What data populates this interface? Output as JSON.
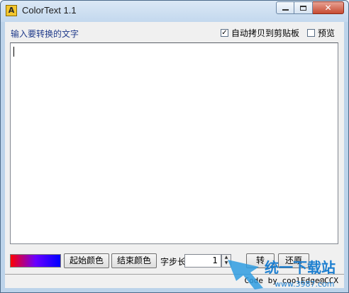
{
  "window": {
    "title": "ColorText 1.1",
    "icon": "app-a-icon",
    "controls": {
      "minimize": "minimize-icon",
      "maximize": "maximize-icon",
      "close": "close-icon",
      "close_glyph": "✕"
    }
  },
  "header": {
    "prompt": "输入要转换的文字",
    "auto_copy": {
      "label": "自动拷贝到剪贴板",
      "checked": true,
      "mark": "✓"
    },
    "preview": {
      "label": "预览",
      "checked": false,
      "mark": ""
    }
  },
  "editor": {
    "value": ""
  },
  "toolbar": {
    "start_color_label": "起始颜色",
    "end_color_label": "结束颜色",
    "step_label": "字步长",
    "step_value": "1",
    "overlay_label_1": "转",
    "restore_label": "还原",
    "gradient": {
      "from": "#ff0000",
      "to": "#0000ff"
    }
  },
  "status": {
    "text": "Code by coolEdge@CCX"
  },
  "watermark": {
    "brand": "统一下载站",
    "url": "www.3987.com"
  }
}
